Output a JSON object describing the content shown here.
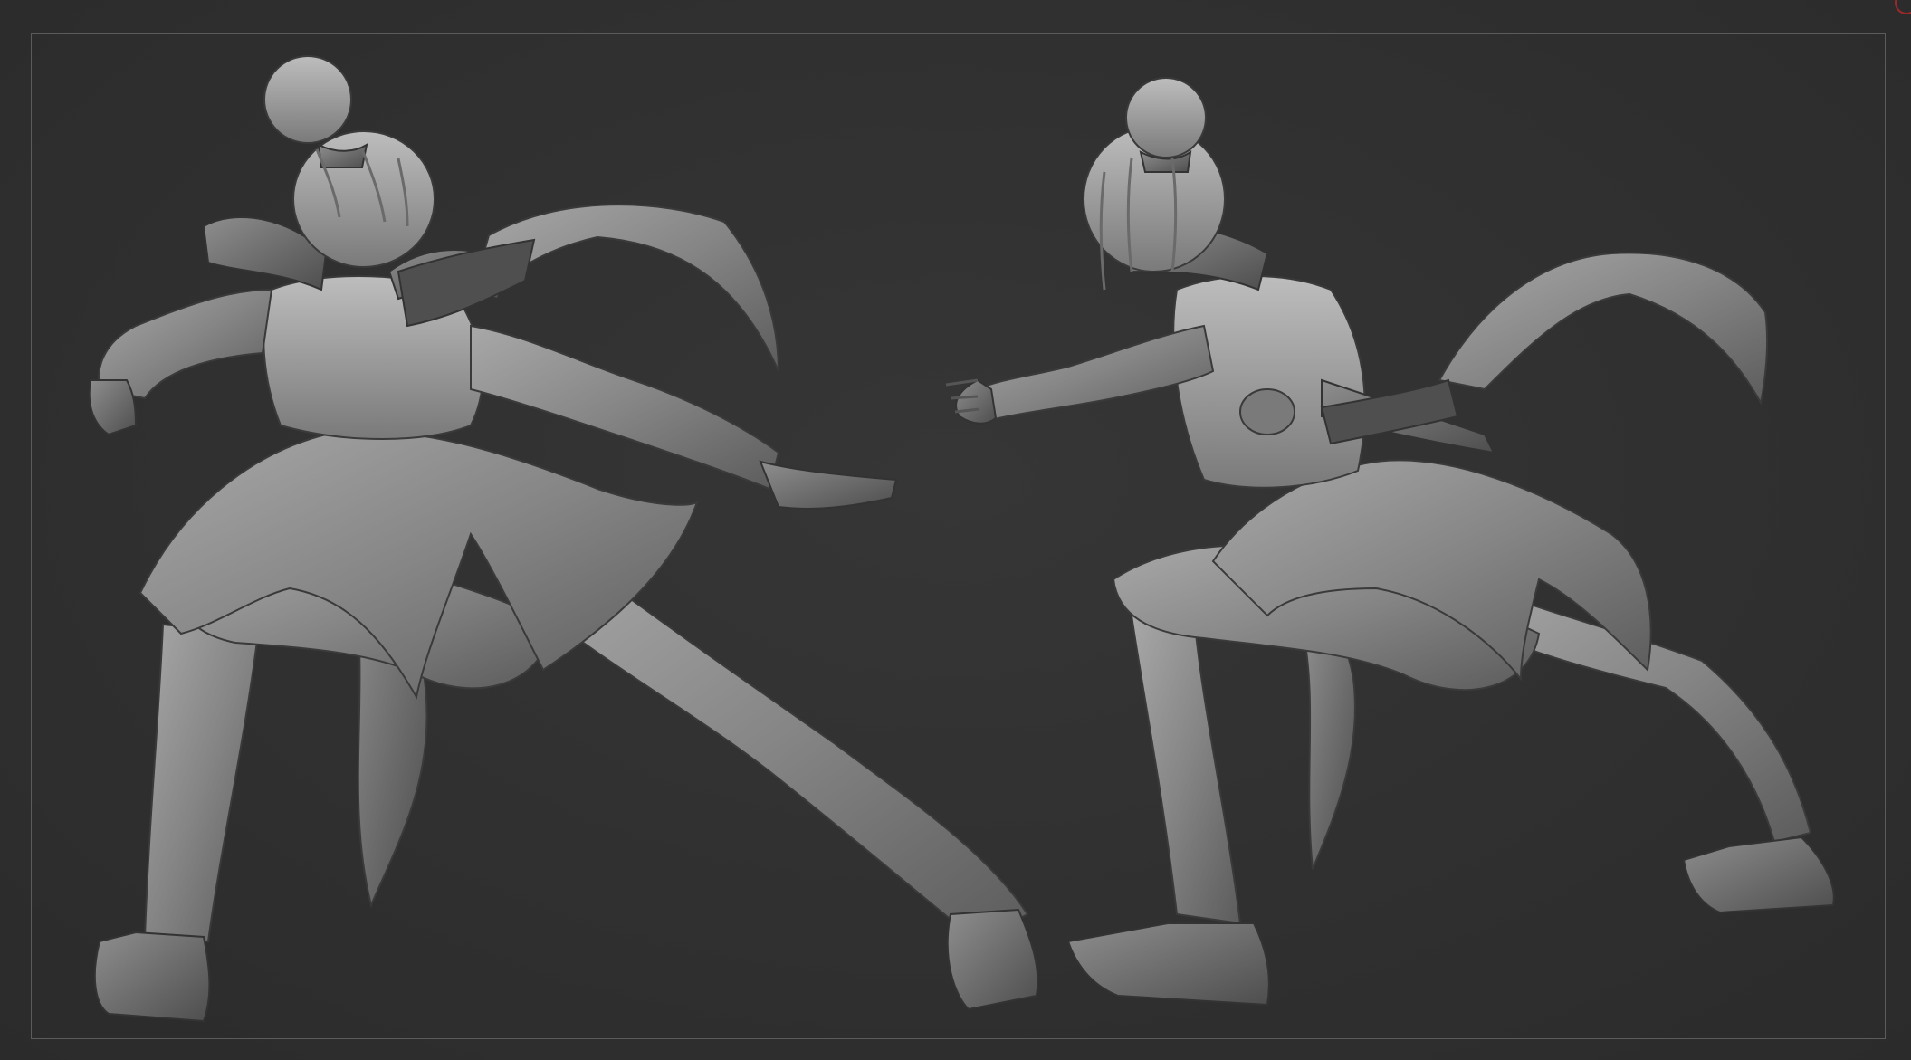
{
  "viewport": {
    "background_color": "#303030",
    "frame_color": "#5b5b5b",
    "indicator_color": "#9a2a2a",
    "model_color": "#8a8a8a"
  },
  "icons": {
    "corner": "rotation-gizmo-icon"
  }
}
